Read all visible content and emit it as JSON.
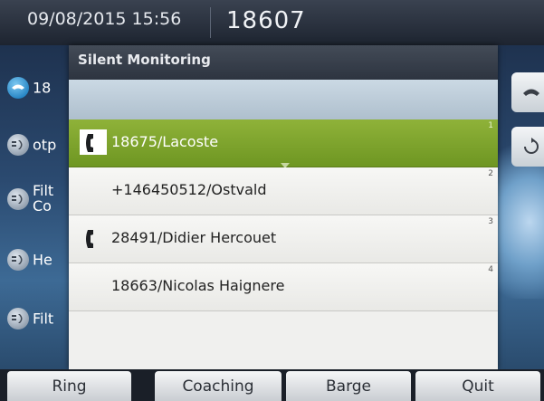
{
  "status_bar": {
    "datetime": "09/08/2015 15:56",
    "line_number": "18607"
  },
  "left_lines": [
    {
      "label": "18",
      "icon": "handset-icon"
    },
    {
      "label": "otp",
      "icon": "line-monitor-icon"
    },
    {
      "label": "Filt",
      "label2": "Co",
      "icon": "line-monitor-icon"
    },
    {
      "label": "He",
      "icon": "line-monitor-icon"
    },
    {
      "label": "Filt",
      "icon": "line-monitor-icon"
    }
  ],
  "dialog": {
    "title": "Silent Monitoring",
    "items": [
      {
        "label": "18675/Lacoste",
        "index": "1",
        "selected": true,
        "phone_icon": true
      },
      {
        "label": "+146450512/Ostvald",
        "index": "2",
        "selected": false,
        "phone_icon": false
      },
      {
        "label": "28491/Didier Hercouet",
        "index": "3",
        "selected": false,
        "phone_icon": true
      },
      {
        "label": "18663/Nicolas Haignere",
        "index": "4",
        "selected": false,
        "phone_icon": false
      }
    ]
  },
  "softkeys": {
    "ring": "Ring",
    "coaching": "Coaching",
    "barge": "Barge",
    "quit": "Quit"
  },
  "colors": {
    "selected_row": "#7ea52d",
    "dialog_header": "#2d3440",
    "search_band": "#bccdd9"
  }
}
